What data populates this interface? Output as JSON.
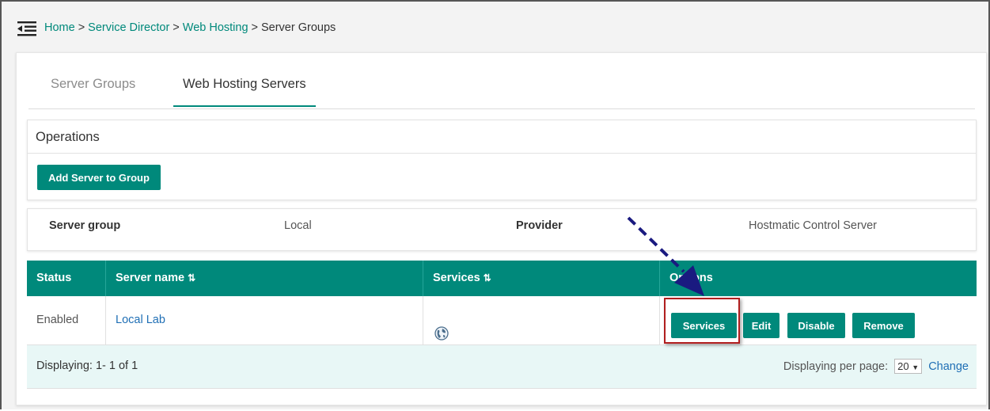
{
  "breadcrumb": {
    "menu_icon": "menu-collapse-icon",
    "items": [
      "Home",
      "Service Director",
      "Web Hosting"
    ],
    "separator": ">",
    "current": "Server Groups"
  },
  "tabs": [
    {
      "label": "Server Groups",
      "active": false
    },
    {
      "label": "Web Hosting Servers",
      "active": true
    }
  ],
  "operations": {
    "title": "Operations",
    "add_button": "Add Server to Group"
  },
  "info": {
    "server_group_label": "Server group",
    "server_group_value": "Local",
    "provider_label": "Provider",
    "provider_value": "Hostmatic Control Server"
  },
  "table": {
    "headers": [
      "Status",
      "Server name",
      "Services",
      "Options"
    ],
    "sort_icon": "sort-icon",
    "rows": [
      {
        "status": "Enabled",
        "server_name": "Local Lab",
        "services_icon": "globe-icon",
        "actions": [
          "Services",
          "Edit",
          "Disable",
          "Remove"
        ]
      }
    ],
    "footer": {
      "displaying": "Displaying: 1- 1 of 1",
      "per_page_label": "Displaying per page:",
      "per_page_value": "20",
      "change_link": "Change"
    }
  },
  "colors": {
    "accent": "#00897b",
    "link": "#1f6fb5",
    "highlight": "#b01e1e",
    "annotation_arrow": "#1a1a80"
  }
}
